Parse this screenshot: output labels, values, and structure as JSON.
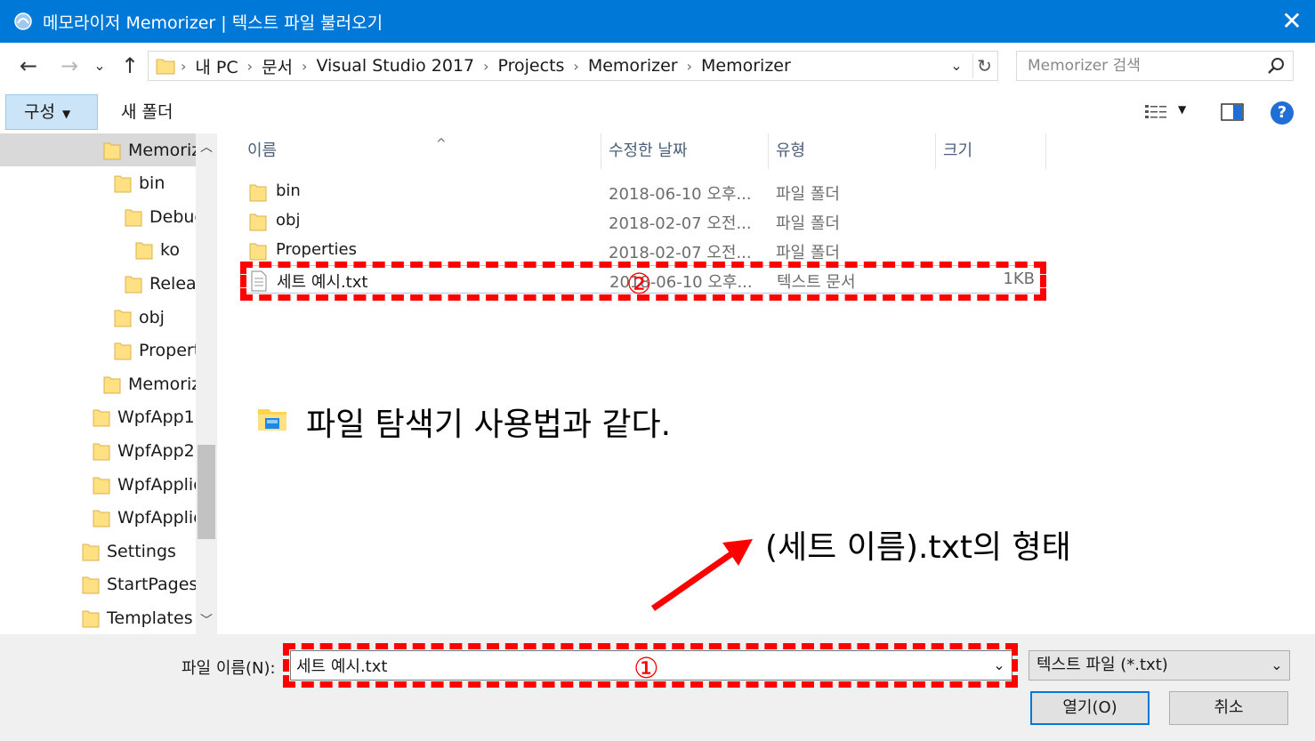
{
  "window": {
    "title": "메모라이저 Memorizer | 텍스트 파일 불러오기",
    "close_glyph": "✕"
  },
  "nav": {
    "back_glyph": "←",
    "forward_glyph": "→",
    "recent_glyph": "⌄",
    "up_glyph": "↑",
    "breadcrumbs": [
      "내 PC",
      "문서",
      "Visual Studio 2017",
      "Projects",
      "Memorizer",
      "Memorizer"
    ],
    "crumb_sep": "›",
    "dropdown_glyph": "⌄",
    "refresh_glyph": "↻",
    "search_placeholder": "Memorizer 검색"
  },
  "toolbar": {
    "organize_label": "구성",
    "organize_caret": "▼",
    "new_folder_label": "새 폴더",
    "view_caret": "▼",
    "help_label": "?"
  },
  "tree": {
    "items": [
      {
        "label": "Memorize",
        "indent": 1,
        "selected": true
      },
      {
        "label": "bin",
        "indent": 2
      },
      {
        "label": "Debug",
        "indent": 3
      },
      {
        "label": "ko",
        "indent": 4
      },
      {
        "label": "Release",
        "indent": 3
      },
      {
        "label": "obj",
        "indent": 2
      },
      {
        "label": "Propertie",
        "indent": 2
      },
      {
        "label": "Memorize",
        "indent": 1
      },
      {
        "label": "WpfApp1",
        "indent": 0
      },
      {
        "label": "WpfApp2",
        "indent": 0
      },
      {
        "label": "WpfApplica",
        "indent": 0
      },
      {
        "label": "WpfApplica",
        "indent": 0
      },
      {
        "label": "Settings",
        "indent": -1
      },
      {
        "label": "StartPages",
        "indent": -1
      },
      {
        "label": "Templates",
        "indent": -1
      }
    ],
    "scroll_up_glyph": "︿",
    "scroll_down_glyph": "﹀"
  },
  "columns": {
    "name": "이름",
    "date": "수정한 날짜",
    "type": "유형",
    "size": "크기",
    "sort_glyph": "^"
  },
  "files": [
    {
      "name": "bin",
      "date": "2018-06-10 오후...",
      "type": "파일 폴더",
      "size": "",
      "kind": "folder"
    },
    {
      "name": "obj",
      "date": "2018-02-07 오전...",
      "type": "파일 폴더",
      "size": "",
      "kind": "folder"
    },
    {
      "name": "Properties",
      "date": "2018-02-07 오전...",
      "type": "파일 폴더",
      "size": "",
      "kind": "folder"
    },
    {
      "name": "세트 예시.txt",
      "date": "2018-06-10 오후...",
      "type": "텍스트 문서",
      "size": "1KB",
      "kind": "text"
    }
  ],
  "bottom": {
    "filename_label": "파일 이름(N):",
    "filename_value": "세트 예시.txt",
    "dropdown_glyph": "⌄",
    "filetype_value": "텍스트 파일 (*.txt)",
    "open_label": "열기(O)",
    "cancel_label": "취소"
  },
  "annotations": {
    "marker_1": "①",
    "marker_2": "②",
    "note_explorer": "파일 탐색기 사용법과 같다.",
    "note_format": "(세트 이름).txt의 형태",
    "color": "#ff0000"
  }
}
